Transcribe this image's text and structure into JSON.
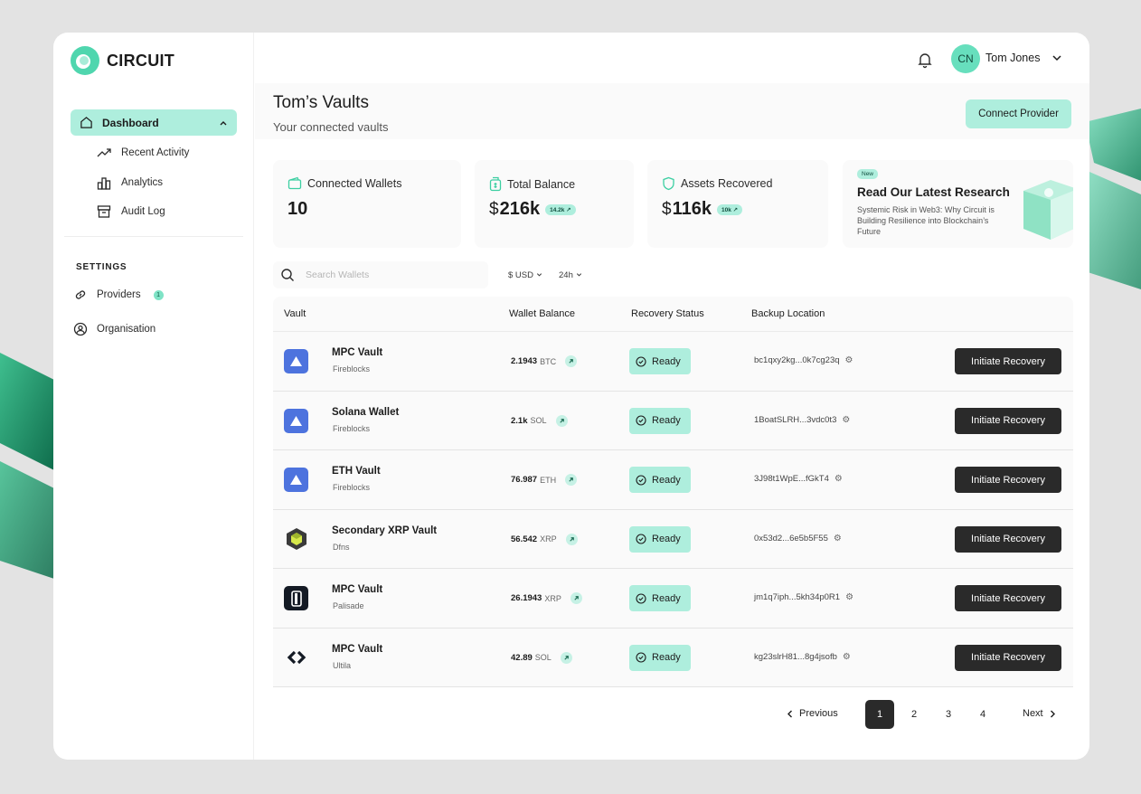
{
  "app": {
    "name": "CIRCUIT"
  },
  "sidebar": {
    "active": {
      "label": "Dashboard"
    },
    "sub": [
      {
        "label": "Recent Activity",
        "icon": "trend-icon"
      },
      {
        "label": "Analytics",
        "icon": "bar-chart-icon"
      },
      {
        "label": "Audit Log",
        "icon": "archive-icon"
      }
    ],
    "settings_title": "SETTINGS",
    "settings": [
      {
        "label": "Providers",
        "icon": "link-icon",
        "count": "1"
      },
      {
        "label": "Organisation",
        "icon": "users-icon"
      }
    ]
  },
  "user": {
    "initials": "CN",
    "name": "Tom Jones"
  },
  "header": {
    "title": "Tom’s Vaults",
    "subtitle": "Your connected vaults",
    "connect_label": "Connect Provider"
  },
  "stats": {
    "wallets": {
      "label": "Connected Wallets",
      "value": "10"
    },
    "balance": {
      "label": "Total Balance",
      "currency": "$",
      "value": "216k",
      "badge": "14.2k ↗"
    },
    "recovered": {
      "label": "Assets Recovered",
      "currency": "$",
      "value": "116k",
      "badge": "10k ↗"
    }
  },
  "research": {
    "badge": "New",
    "title": "Read Our Latest Research",
    "text": "Systemic Risk in Web3: Why Circuit is Building Resilience into Blockchain’s Future"
  },
  "filters": {
    "search_placeholder": "Search Wallets",
    "currency": "$ USD",
    "period": "24h"
  },
  "table": {
    "headers": {
      "vault": "Vault",
      "balance": "Wallet Balance",
      "status": "Recovery Status",
      "backup": "Backup Location"
    },
    "action_label": "Initiate Recovery",
    "rows": [
      {
        "name": "MPC Vault",
        "provider": "Fireblocks",
        "amount": "2.1943",
        "unit": "BTC",
        "status": "Ready",
        "backup": "bc1qxy2kg...0k7cg23q"
      },
      {
        "name": "Solana Wallet",
        "provider": "Fireblocks",
        "amount": "2.1k",
        "unit": "SOL",
        "status": "Ready",
        "backup": "1BoatSLRH...3vdc0t3"
      },
      {
        "name": "ETH Vault",
        "provider": "Fireblocks",
        "amount": "76.987",
        "unit": "ETH",
        "status": "Ready",
        "backup": "3J98t1WpE...fGkT4"
      },
      {
        "name": "Secondary XRP Vault",
        "provider": "Dfns",
        "amount": "56.542",
        "unit": "XRP",
        "status": "Ready",
        "backup": "0x53d2...6e5b5F55"
      },
      {
        "name": "MPC Vault",
        "provider": "Palisade",
        "amount": "26.1943",
        "unit": "XRP",
        "status": "Ready",
        "backup": "jm1q7iph...5kh34p0R1"
      },
      {
        "name": "MPC Vault",
        "provider": "Ultila",
        "amount": "42.89",
        "unit": "SOL",
        "status": "Ready",
        "backup": "kg23slrH81...8g4jsofb"
      }
    ]
  },
  "pagination": {
    "prev": "Previous",
    "next": "Next",
    "pages": [
      "1",
      "2",
      "3",
      "4"
    ],
    "current": "1"
  },
  "colors": {
    "accent": "#aeeedd",
    "accent_strong": "#67dfbd",
    "dark_button": "#2a2a2a"
  }
}
